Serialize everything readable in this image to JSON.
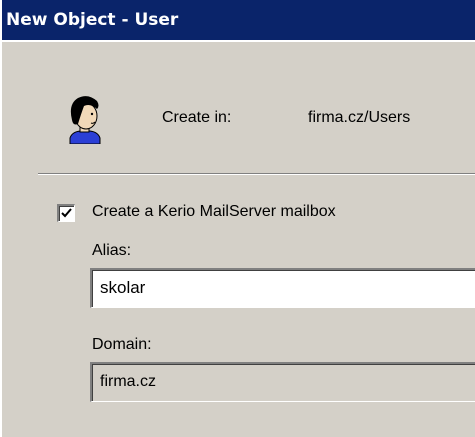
{
  "window": {
    "title": "New Object - User",
    "titlebar_color": "#0a246a"
  },
  "header": {
    "icon": "user-icon",
    "create_in_label": "Create in:",
    "create_in_value": "firma.cz/Users"
  },
  "mailbox": {
    "checkbox_checked": true,
    "checkbox_label": "Create a Kerio MailServer mailbox",
    "alias_label": "Alias:",
    "alias_value": "skolar",
    "domain_label": "Domain:",
    "domain_value": "firma.cz"
  }
}
